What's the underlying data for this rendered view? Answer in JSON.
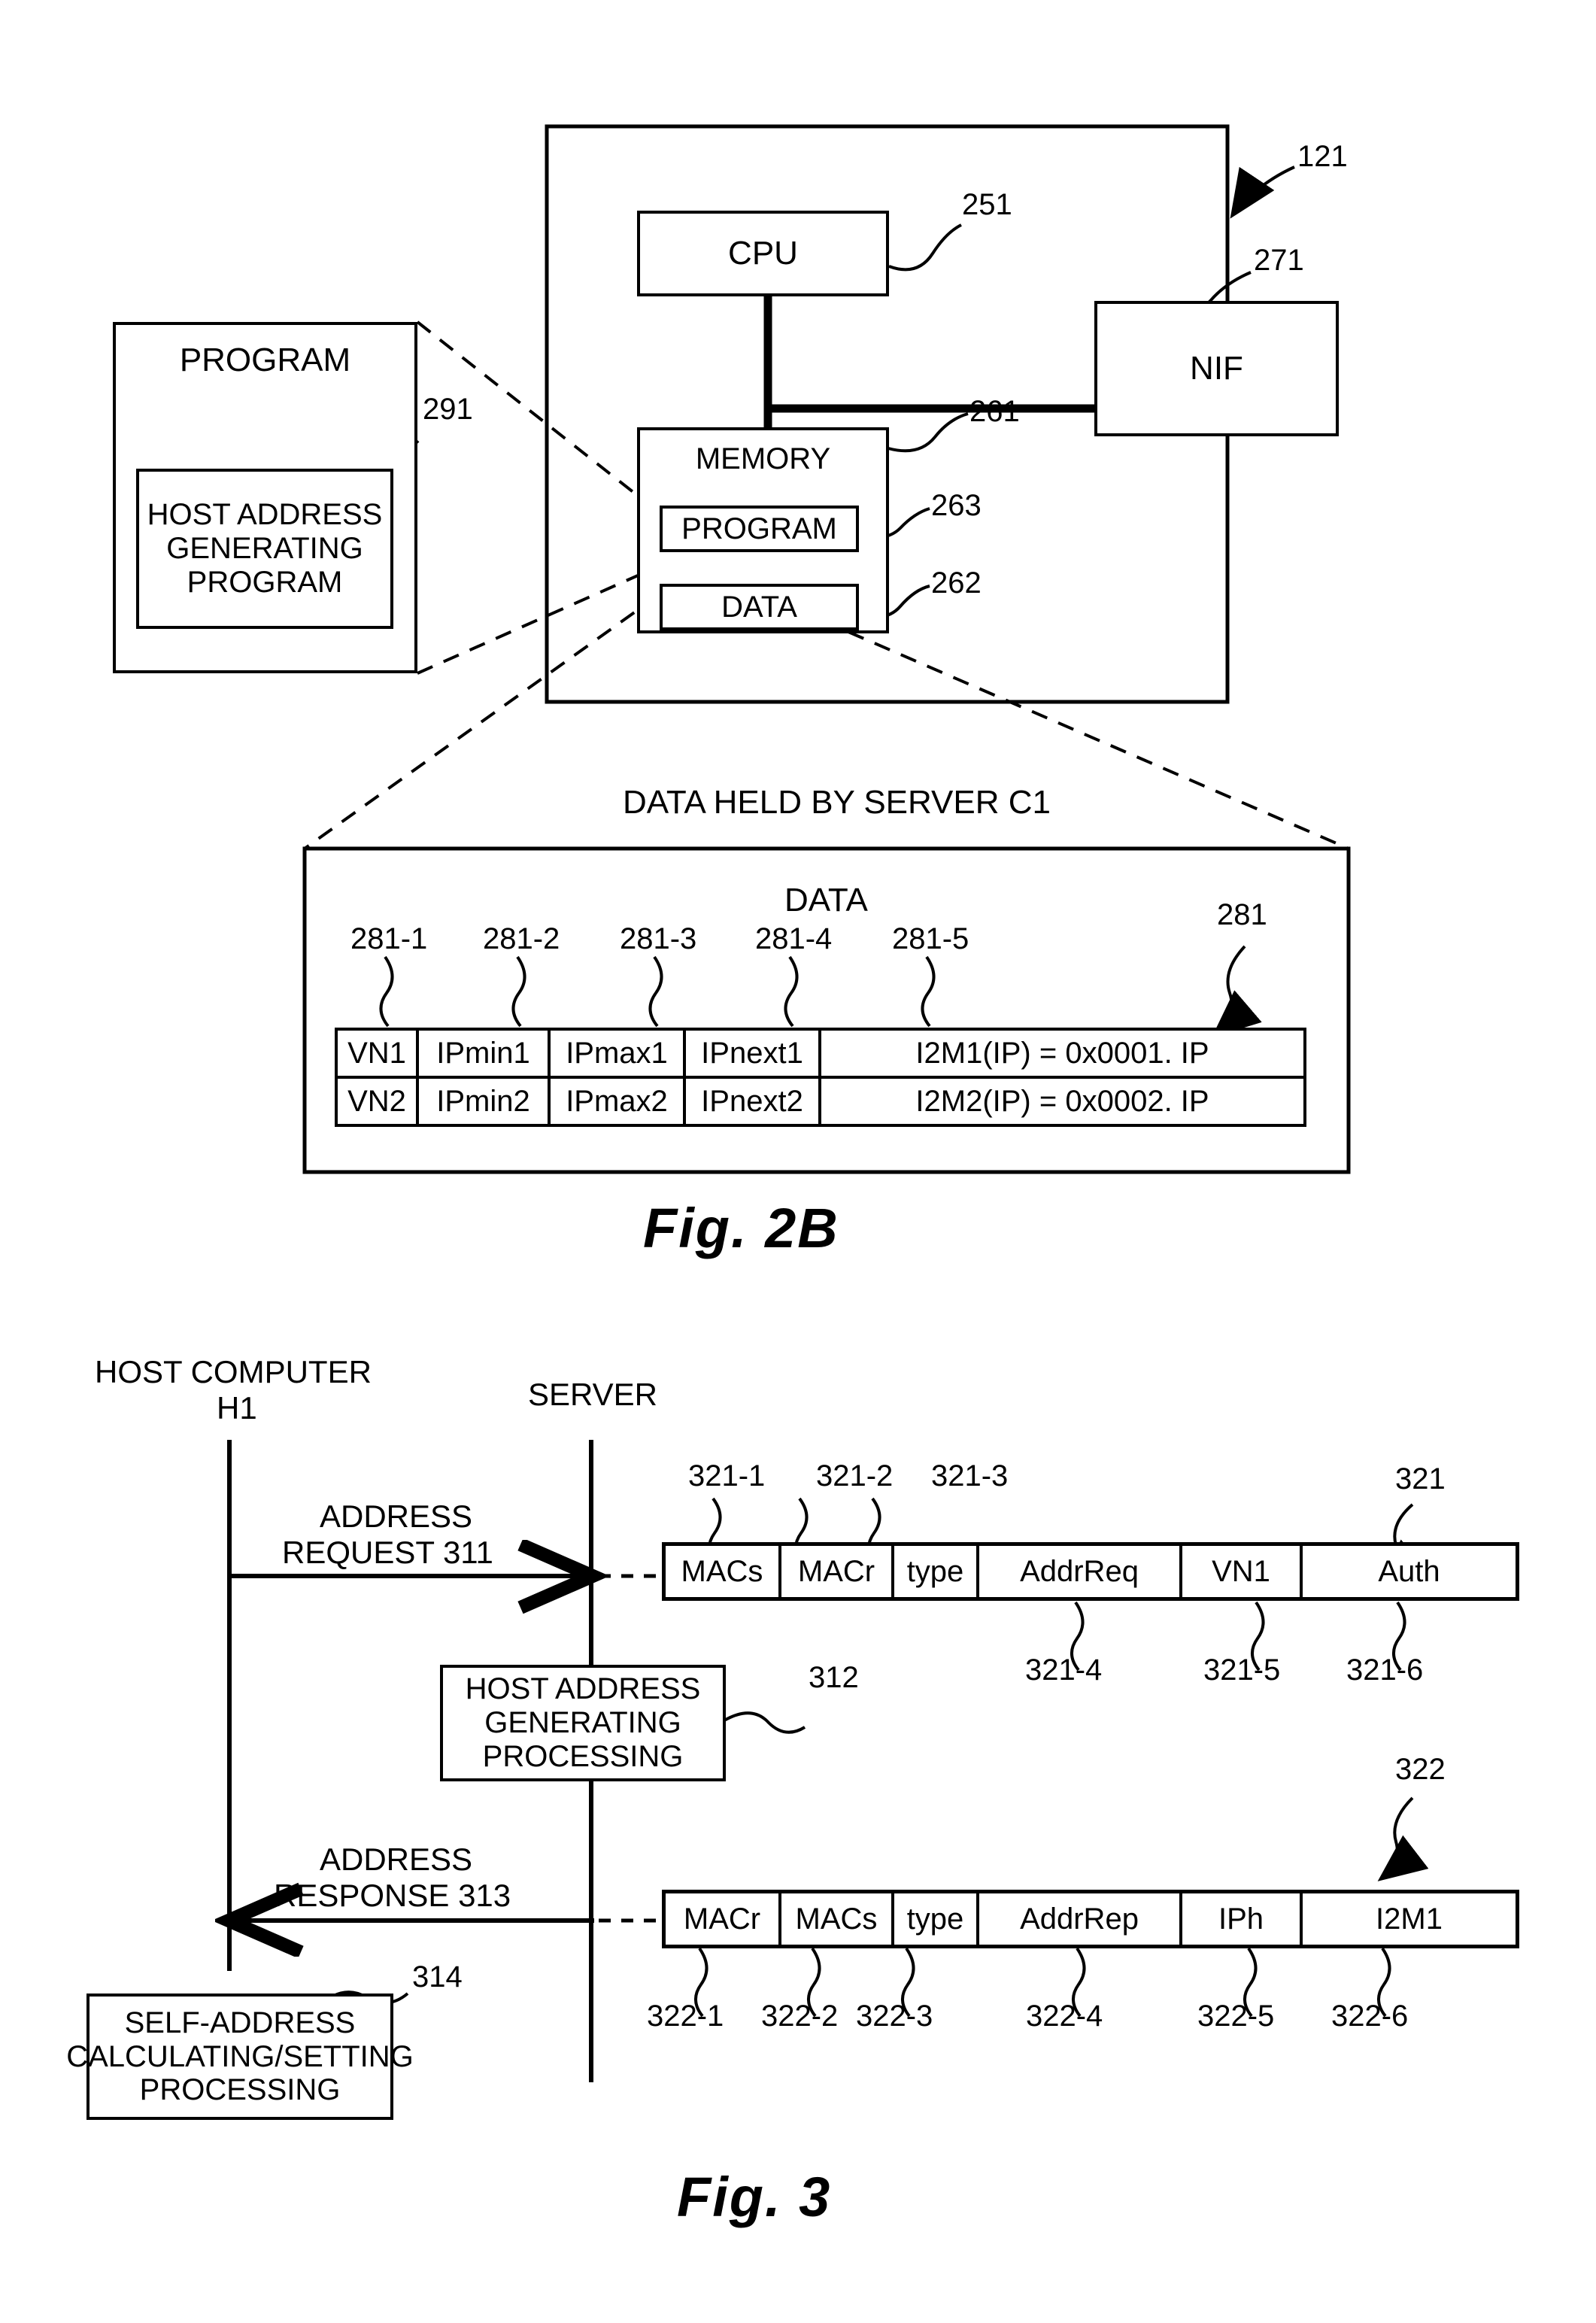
{
  "figure2b": {
    "caption": "Fig. 2B",
    "server_ref": "121",
    "left_program_box": {
      "title": "PROGRAM",
      "ref": "291",
      "inner_title": "HOST ADDRESS\nGENERATING\nPROGRAM"
    },
    "cpu": {
      "label": "CPU",
      "ref": "251"
    },
    "nif": {
      "label": "NIF",
      "ref": "271"
    },
    "memory": {
      "label": "MEMORY",
      "ref": "261",
      "program": {
        "label": "PROGRAM",
        "ref": "263"
      },
      "data": {
        "label": "DATA",
        "ref": "262"
      }
    },
    "detail": {
      "title": "DATA HELD BY SERVER C1",
      "table_title": "DATA",
      "table_ref": "281",
      "column_refs": [
        "281-1",
        "281-2",
        "281-3",
        "281-4",
        "281-5"
      ],
      "rows": [
        [
          "VN1",
          "IPmin1",
          "IPmax1",
          "IPnext1",
          "I2M1(IP) = 0x0001. IP"
        ],
        [
          "VN2",
          "IPmin2",
          "IPmax2",
          "IPnext2",
          "I2M2(IP) = 0x0002. IP"
        ]
      ]
    }
  },
  "figure3": {
    "caption": "Fig. 3",
    "actors": {
      "host": "HOST COMPUTER\nH1",
      "host_line1": "HOST COMPUTER",
      "host_line2": "H1",
      "server": "SERVER"
    },
    "messages": {
      "request": {
        "line1": "ADDRESS",
        "line2": "REQUEST  311"
      },
      "response": {
        "line1": "ADDRESS",
        "line2": "RESPONSE 313"
      }
    },
    "server_process": {
      "text": "HOST ADDRESS\nGENERATING\nPROCESSING",
      "ref": "312"
    },
    "host_process": {
      "text": "SELF-ADDRESS\nCALCULATING/SETTING\nPROCESSING",
      "ref": "314"
    },
    "request_packet": {
      "ref": "321",
      "fields": [
        "MACs",
        "MACr",
        "type",
        "AddrReq",
        "VN1",
        "Auth"
      ],
      "refs_above": [
        "321-1",
        "321-2",
        "321-3"
      ],
      "refs_below": [
        "321-4",
        "321-5",
        "321-6"
      ]
    },
    "response_packet": {
      "ref": "322",
      "fields": [
        "MACr",
        "MACs",
        "type",
        "AddrRep",
        "IPh",
        "I2M1"
      ],
      "refs_below": [
        "322-1",
        "322-2",
        "322-3",
        "322-4",
        "322-5",
        "322-6"
      ]
    }
  }
}
